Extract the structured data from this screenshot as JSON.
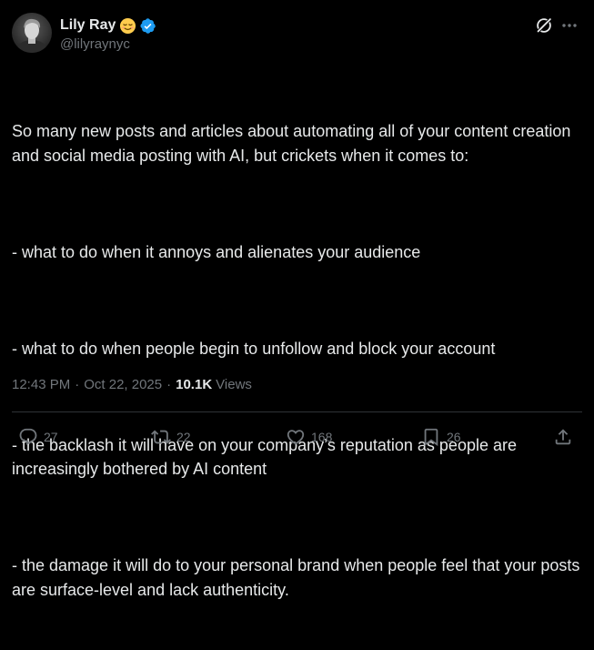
{
  "author": {
    "name": "Lily Ray",
    "emoji": "relieved-face-emoji",
    "verified_badge": "verified-badge-icon",
    "handle": "@lilyraynyc"
  },
  "header_icons": [
    "grok-icon",
    "more-options-icon"
  ],
  "tweet": {
    "paragraphs": [
      "So many new posts and articles about automating all of your content creation and social media posting with AI, but crickets when it comes to:",
      "- what to do when it annoys and alienates your audience",
      "- what to do when people begin to unfollow and block your account",
      "- the backlash it will have on your company’s reputation as people are increasingly bothered by AI content",
      "- the damage it will do to your personal brand when people feel that your posts are surface-level and lack authenticity."
    ]
  },
  "meta": {
    "time": "12:43 PM",
    "separator": "·",
    "date": "Oct 22, 2025",
    "views_count": "10.1K",
    "views_label": "Views"
  },
  "actions": {
    "reply": {
      "icon": "reply-icon",
      "count": "27"
    },
    "repost": {
      "icon": "repost-icon",
      "count": "22"
    },
    "like": {
      "icon": "heart-icon",
      "count": "168"
    },
    "bookmark": {
      "icon": "bookmark-icon",
      "count": "26"
    },
    "share": {
      "icon": "share-icon"
    }
  },
  "colors": {
    "background": "#000000",
    "text": "#e7e9ea",
    "secondary": "#71767b",
    "verified": "#1d9bf0",
    "divider": "#2f3336"
  }
}
